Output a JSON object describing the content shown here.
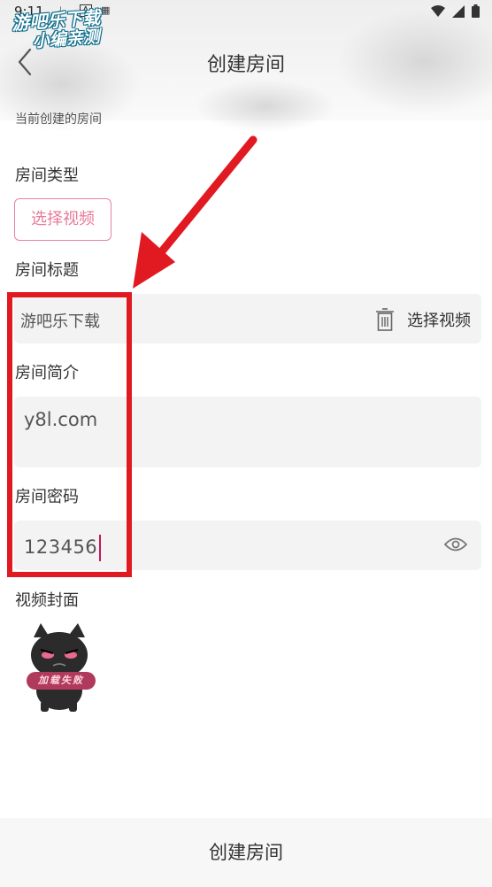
{
  "status_bar": {
    "time": "9:11",
    "mini_icon_text": "A"
  },
  "watermark": {
    "line1": "游吧乐下载",
    "line2": "小编亲测"
  },
  "header": {
    "title": "创建房间"
  },
  "form": {
    "section_hint": "当前创建的房间",
    "room_type_label": "房间类型",
    "select_video_button": "选择视频",
    "room_title_label": "房间标题",
    "room_title_value": "游吧乐下载",
    "title_select_video": "选择视频",
    "room_intro_label": "房间简介",
    "room_intro_value": "y8l.com",
    "room_password_label": "房间密码",
    "room_password_value": "123456",
    "cover_label": "视频封面",
    "cover_badge_text": "加载失败"
  },
  "footer": {
    "create_button": "创建房间"
  },
  "colors": {
    "accent_pink": "#e87a97",
    "highlight_red": "#e11a22",
    "cursor": "#c2185b"
  }
}
